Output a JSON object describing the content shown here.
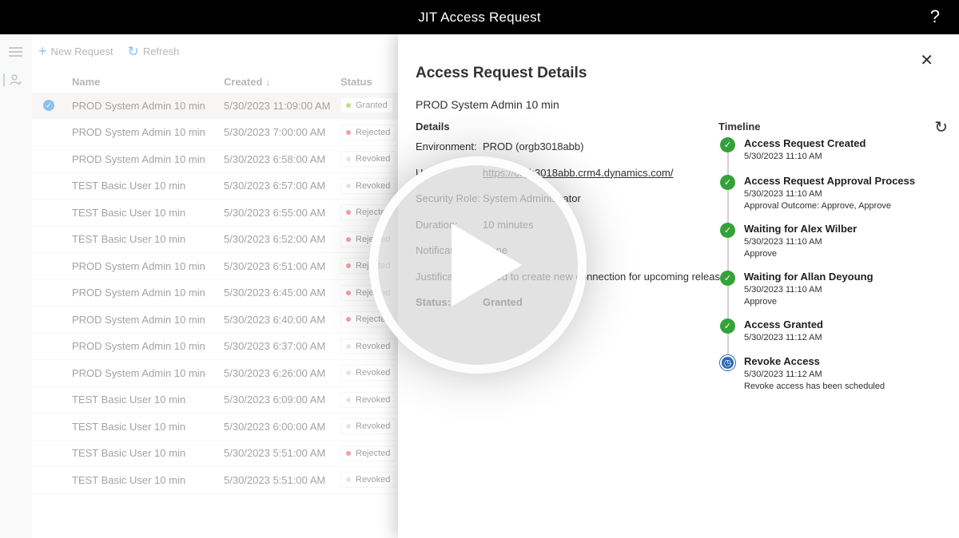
{
  "app": {
    "title": "JIT Access Request",
    "help": "?"
  },
  "commands": {
    "new_request": "New Request",
    "refresh": "Refresh"
  },
  "grid": {
    "columns": {
      "name": "Name",
      "created": "Created ↓",
      "status": "Status"
    },
    "rows": [
      {
        "name": "PROD System Admin 10 min",
        "created": "5/30/2023 11:09:00 AM",
        "status": "Granted",
        "selected": true
      },
      {
        "name": "PROD System Admin 10 min",
        "created": "5/30/2023 7:00:00 AM",
        "status": "Rejected"
      },
      {
        "name": "PROD System Admin 10 min",
        "created": "5/30/2023 6:58:00 AM",
        "status": "Revoked"
      },
      {
        "name": "TEST Basic User 10 min",
        "created": "5/30/2023 6:57:00 AM",
        "status": "Revoked"
      },
      {
        "name": "TEST Basic User 10 min",
        "created": "5/30/2023 6:55:00 AM",
        "status": "Rejected"
      },
      {
        "name": "TEST Basic User 10 min",
        "created": "5/30/2023 6:52:00 AM",
        "status": "Rejected"
      },
      {
        "name": "PROD System Admin 10 min",
        "created": "5/30/2023 6:51:00 AM",
        "status": "Rejected"
      },
      {
        "name": "PROD System Admin 10 min",
        "created": "5/30/2023 6:45:00 AM",
        "status": "Rejected"
      },
      {
        "name": "PROD System Admin 10 min",
        "created": "5/30/2023 6:40:00 AM",
        "status": "Rejected"
      },
      {
        "name": "PROD System Admin 10 min",
        "created": "5/30/2023 6:37:00 AM",
        "status": "Revoked"
      },
      {
        "name": "PROD System Admin 10 min",
        "created": "5/30/2023 6:26:00 AM",
        "status": "Revoked"
      },
      {
        "name": "TEST Basic User 10 min",
        "created": "5/30/2023 6:09:00 AM",
        "status": "Revoked"
      },
      {
        "name": "TEST Basic User 10 min",
        "created": "5/30/2023 6:00:00 AM",
        "status": "Revoked"
      },
      {
        "name": "TEST Basic User 10 min",
        "created": "5/30/2023 5:51:00 AM",
        "status": "Rejected"
      },
      {
        "name": "TEST Basic User 10 min",
        "created": "5/30/2023 5:51:00 AM",
        "status": "Revoked"
      }
    ],
    "status_colors": {
      "Granted": "#6bb700",
      "Rejected": "#d13438",
      "Revoked": "#c8c6c4"
    }
  },
  "panel": {
    "title": "Access Request Details",
    "close": "✕",
    "subtitle": "PROD System Admin 10 min",
    "details_label": "Details",
    "details": [
      {
        "key": "Environment:",
        "value": "PROD (orgb3018abb)"
      },
      {
        "key": "Url:",
        "value": "https://orgb3018abb.crm4.dynamics.com/",
        "link": true
      },
      {
        "key": "Security Role:",
        "value": "System Administrator"
      },
      {
        "key": "Duration:",
        "value": "10 minutes"
      },
      {
        "key": "Notification:",
        "value": "None"
      },
      {
        "key": "Justification:",
        "value": "Need to create new connection for upcoming release"
      },
      {
        "key": "Status:",
        "value": "Granted",
        "bold": true
      }
    ],
    "timeline_label": "Timeline",
    "timeline": [
      {
        "title": "Access Request Created",
        "date": "5/30/2023 11:10 AM",
        "note": "",
        "state": "done"
      },
      {
        "title": "Access Request Approval Process",
        "date": "5/30/2023 11:10 AM",
        "note": "Approval Outcome: Approve, Approve",
        "state": "done"
      },
      {
        "title": "Waiting for Alex Wilber",
        "date": "5/30/2023 11:10 AM",
        "note": "Approve",
        "state": "done"
      },
      {
        "title": "Waiting for Allan Deyoung",
        "date": "5/30/2023 11:10 AM",
        "note": "Approve",
        "state": "done"
      },
      {
        "title": "Access Granted",
        "date": "5/30/2023 11:12 AM",
        "note": "",
        "state": "done"
      },
      {
        "title": "Revoke Access",
        "date": "5/30/2023 11:12 AM",
        "note": "Revoke access has been scheduled",
        "state": "scheduled"
      }
    ]
  },
  "icons": {
    "menu": "hamburger-icon",
    "user": "person-icon",
    "add": "plus-icon",
    "refresh": "refresh-icon",
    "check": "checkmark-icon",
    "clock": "clock-icon",
    "play": "play-icon"
  },
  "colors": {
    "accent": "#0078d4",
    "success": "#35a13a",
    "scheduled": "#2b67b3"
  }
}
